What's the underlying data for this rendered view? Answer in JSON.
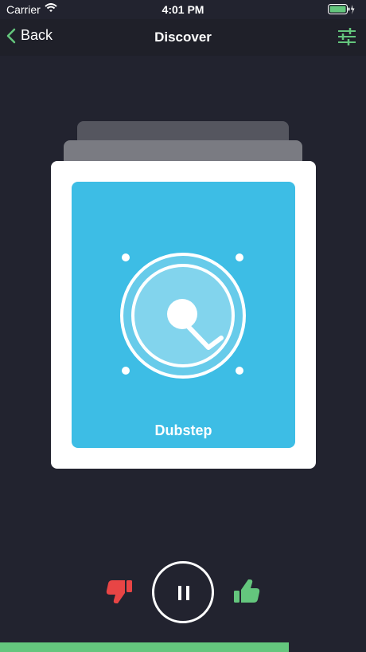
{
  "status": {
    "carrier": "Carrier",
    "time": "4:01 PM"
  },
  "nav": {
    "back_label": "Back",
    "title": "Discover"
  },
  "card": {
    "genre": "Dubstep"
  },
  "player": {
    "progress": 0.79
  },
  "icons": {
    "back": "chevron-left-icon",
    "filter": "sliders-icon",
    "dislike": "thumbs-down-icon",
    "pause": "pause-icon",
    "like": "thumbs-up-icon"
  },
  "colors": {
    "accent": "#64c67d",
    "dislike": "#e84545",
    "card_art": "#3dbde5",
    "background": "#22232f"
  }
}
